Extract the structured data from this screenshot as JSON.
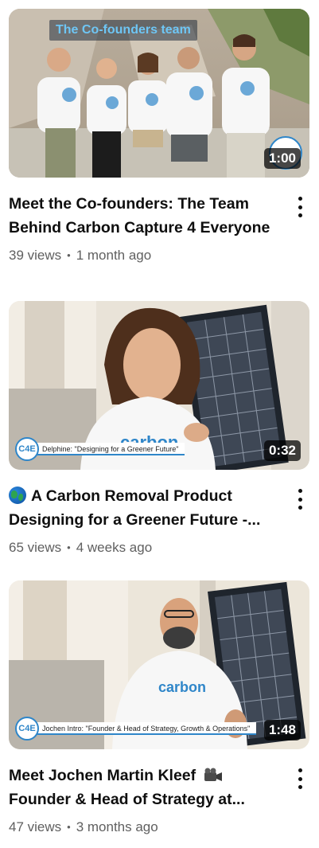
{
  "videos": [
    {
      "title": "Meet the Co-founders: The Team Behind Carbon Capture 4 Everyone",
      "views": "39 views",
      "age": "1 month ago",
      "duration": "1:00",
      "overlay_text": "The Co-founders team",
      "icon": "more-vert-icon"
    },
    {
      "title_prefix_icon": "globe-emoji",
      "title": "A Carbon Removal Product Designing for a Greener Future -...",
      "views": "65 views",
      "age": "4 weeks ago",
      "duration": "0:32",
      "lower_third": "Delphine: \"Designing for a Greener Future\"",
      "icon": "more-vert-icon"
    },
    {
      "title": "Meet Jochen Martin Kleef",
      "title_suffix_icon": "video-camera-emoji",
      "title_line2": "Founder & Head of Strategy at...",
      "views": "47 views",
      "age": "3 months ago",
      "duration": "1:48",
      "lower_third": "Jochen Intro: \"Founder & Head of Strategy, Growth & Operations\"",
      "icon": "more-vert-icon"
    }
  ],
  "separator": "•",
  "colors": {
    "text": "#0f0f0f",
    "secondary": "#606060",
    "badge_bg": "#000000b8",
    "brand_blue": "#2f86c9"
  },
  "logo_text": "C4E"
}
